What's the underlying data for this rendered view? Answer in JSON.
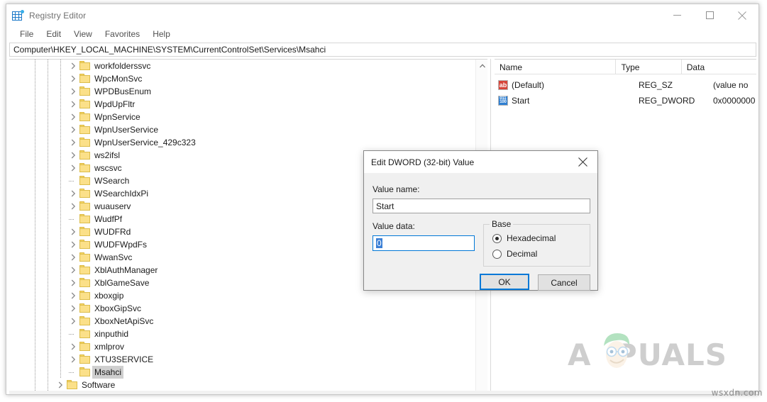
{
  "window": {
    "title": "Registry Editor",
    "icon": "registry-editor-icon",
    "controls": {
      "minimize": "minimize",
      "maximize": "maximize",
      "close": "close"
    }
  },
  "menubar": {
    "items": [
      "File",
      "Edit",
      "View",
      "Favorites",
      "Help"
    ]
  },
  "addressbar": {
    "path": "Computer\\HKEY_LOCAL_MACHINE\\SYSTEM\\CurrentControlSet\\Services\\Msahci"
  },
  "tree": {
    "items": [
      {
        "label": "workfolderssvc",
        "indent": 3,
        "expandable": true,
        "selected": false
      },
      {
        "label": "WpcMonSvc",
        "indent": 3,
        "expandable": true,
        "selected": false
      },
      {
        "label": "WPDBusEnum",
        "indent": 3,
        "expandable": true,
        "selected": false
      },
      {
        "label": "WpdUpFltr",
        "indent": 3,
        "expandable": true,
        "selected": false
      },
      {
        "label": "WpnService",
        "indent": 3,
        "expandable": true,
        "selected": false
      },
      {
        "label": "WpnUserService",
        "indent": 3,
        "expandable": true,
        "selected": false
      },
      {
        "label": "WpnUserService_429c323",
        "indent": 3,
        "expandable": true,
        "selected": false
      },
      {
        "label": "ws2ifsl",
        "indent": 3,
        "expandable": true,
        "selected": false
      },
      {
        "label": "wscsvc",
        "indent": 3,
        "expandable": true,
        "selected": false
      },
      {
        "label": "WSearch",
        "indent": 3,
        "expandable": false,
        "selected": false
      },
      {
        "label": "WSearchIdxPi",
        "indent": 3,
        "expandable": true,
        "selected": false
      },
      {
        "label": "wuauserv",
        "indent": 3,
        "expandable": true,
        "selected": false
      },
      {
        "label": "WudfPf",
        "indent": 3,
        "expandable": false,
        "selected": false
      },
      {
        "label": "WUDFRd",
        "indent": 3,
        "expandable": true,
        "selected": false
      },
      {
        "label": "WUDFWpdFs",
        "indent": 3,
        "expandable": true,
        "selected": false
      },
      {
        "label": "WwanSvc",
        "indent": 3,
        "expandable": true,
        "selected": false
      },
      {
        "label": "XblAuthManager",
        "indent": 3,
        "expandable": true,
        "selected": false
      },
      {
        "label": "XblGameSave",
        "indent": 3,
        "expandable": true,
        "selected": false
      },
      {
        "label": "xboxgip",
        "indent": 3,
        "expandable": true,
        "selected": false
      },
      {
        "label": "XboxGipSvc",
        "indent": 3,
        "expandable": true,
        "selected": false
      },
      {
        "label": "XboxNetApiSvc",
        "indent": 3,
        "expandable": true,
        "selected": false
      },
      {
        "label": "xinputhid",
        "indent": 3,
        "expandable": false,
        "selected": false
      },
      {
        "label": "xmlprov",
        "indent": 3,
        "expandable": true,
        "selected": false
      },
      {
        "label": "XTU3SERVICE",
        "indent": 3,
        "expandable": true,
        "selected": false
      },
      {
        "label": "Msahci",
        "indent": 3,
        "expandable": false,
        "selected": true
      },
      {
        "label": "Software",
        "indent": 2,
        "expandable": true,
        "selected": false
      }
    ]
  },
  "listview": {
    "columns": [
      "Name",
      "Type",
      "Data"
    ],
    "rows": [
      {
        "name": "(Default)",
        "type": "REG_SZ",
        "data": "(value no",
        "icon": "string-value-icon"
      },
      {
        "name": "Start",
        "type": "REG_DWORD",
        "data": "0x0000000",
        "icon": "dword-value-icon"
      }
    ]
  },
  "dialog": {
    "title": "Edit DWORD (32-bit) Value",
    "close_icon": "close-icon",
    "value_name_label": "Value name:",
    "value_name": "Start",
    "value_data_label": "Value data:",
    "value_data": "0",
    "base_group_label": "Base",
    "base_options": [
      {
        "label": "Hexadecimal",
        "selected": true
      },
      {
        "label": "Decimal",
        "selected": false
      }
    ],
    "ok_label": "OK",
    "cancel_label": "Cancel"
  },
  "watermarks": {
    "brand": "PUALS",
    "brand_first_letter": "A",
    "site": "wsxdn.com"
  },
  "colors": {
    "accent": "#0078d7",
    "selection": "#3a7fd5",
    "folder": "#fbe089",
    "title_text": "#707070"
  }
}
